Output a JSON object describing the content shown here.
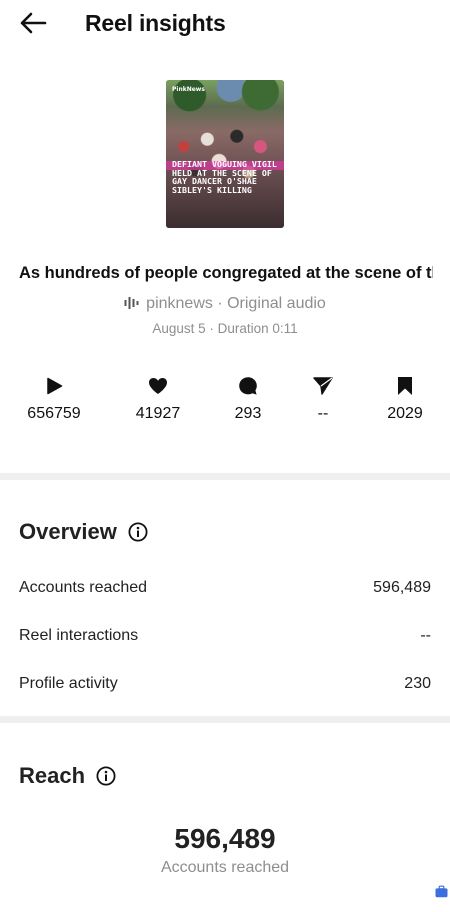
{
  "header": {
    "title": "Reel insights",
    "back_icon": "arrow-left-icon"
  },
  "reel": {
    "thumbnail": {
      "brand": "PinkNews",
      "overlay_text": "DEFIANT VOGUING VIGIL HELD AT THE SCENE OF GAY DANCER O'SHAE SIBLEY'S KILLING",
      "accent_color": "#d63a9e"
    },
    "caption": "As hundreds of people congregated at the scene of th...",
    "audio": {
      "icon": "audio-waveform-icon",
      "text": "pinknews · Original audio"
    },
    "meta": "August 5 · Duration 0:11"
  },
  "stats": [
    {
      "icon": "play-icon",
      "value": "656759"
    },
    {
      "icon": "heart-icon",
      "value": "41927"
    },
    {
      "icon": "comment-icon",
      "value": "293"
    },
    {
      "icon": "share-icon",
      "value": "--"
    },
    {
      "icon": "bookmark-icon",
      "value": "2029"
    }
  ],
  "overview": {
    "title": "Overview",
    "info_icon": "info-icon",
    "rows": [
      {
        "label": "Accounts reached",
        "value": "596,489"
      },
      {
        "label": "Reel interactions",
        "value": "--"
      },
      {
        "label": "Profile activity",
        "value": "230"
      }
    ]
  },
  "reach": {
    "title": "Reach",
    "info_icon": "info-icon",
    "number": "596,489",
    "label": "Accounts reached"
  },
  "floating": {
    "icon": "briefcase-icon",
    "color": "#3b6fe0"
  },
  "colors": {
    "text": "#111111",
    "secondary": "#8e8e8e",
    "divider": "#efefef"
  }
}
